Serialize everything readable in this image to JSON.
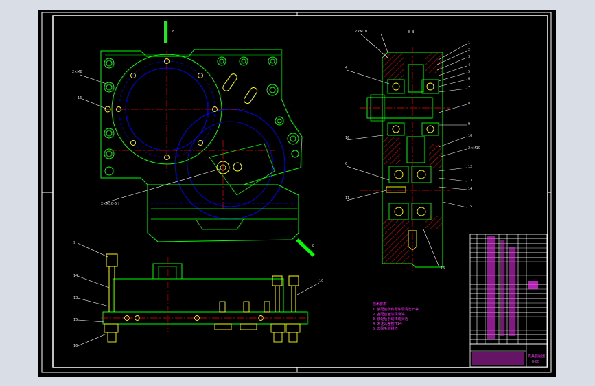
{
  "drawing": {
    "section_label": "B-B",
    "arrow_mark": "8",
    "dim_top_left": "2×M8",
    "dim_bottom_left": "2×M10-6H",
    "side_dim": "2×M10",
    "callouts_right": [
      "1",
      "2",
      "3",
      "4",
      "5",
      "6",
      "7",
      "8",
      "9",
      "10",
      "11",
      "12",
      "13",
      "14",
      "15",
      "16"
    ],
    "callouts_left": [
      "2×M10",
      "4",
      "16",
      "6",
      "11",
      "12"
    ],
    "front_callouts": [
      "9",
      "14",
      "13",
      "15",
      "16",
      "10"
    ],
    "notes_title": "技术要求",
    "notes": [
      "1. 装配前所有零件须清洗干净",
      "2. 各配合面涂润滑油",
      "3. 装配后手动转动灵活",
      "4. 未注公差按IT14",
      "5. 去除毛刺锐边"
    ],
    "title_block": {
      "title": "夹具装配图",
      "drawing_no": "JJ-00",
      "scale": "1:1",
      "rows": 24
    }
  },
  "colors": {
    "background": "#000000",
    "frame": "#ffffff",
    "outline": "#00ff00",
    "hidden": "#0000ff",
    "center": "#ff0000",
    "hatch": "#ff0000",
    "leader": "#ff00ff",
    "yellow": "#ffff00",
    "cyan": "#00ffff"
  }
}
